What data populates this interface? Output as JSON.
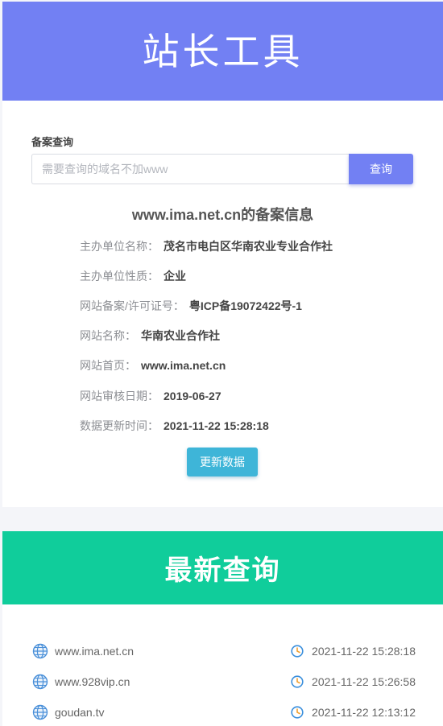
{
  "header": {
    "title": "站长工具"
  },
  "search": {
    "label": "备案查询",
    "placeholder": "需要查询的域名不加www",
    "button_label": "查询"
  },
  "info": {
    "title": "www.ima.net.cn的备案信息",
    "rows": [
      {
        "key": "主办单位名称：",
        "value": "茂名市电白区华南农业专业合作社"
      },
      {
        "key": "主办单位性质：",
        "value": "企业"
      },
      {
        "key": "网站备案/许可证号：",
        "value": "粤ICP备19072422号-1"
      },
      {
        "key": "网站名称：",
        "value": "华南农业合作社"
      },
      {
        "key": "网站首页：",
        "value": "www.ima.net.cn"
      },
      {
        "key": "网站审核日期：",
        "value": "2019-06-27"
      },
      {
        "key": "数据更新时间：",
        "value": "2021-11-22 15:28:18"
      }
    ],
    "update_button": "更新数据"
  },
  "recent": {
    "title": "最新查询",
    "items": [
      {
        "domain": "www.ima.net.cn",
        "time": "2021-11-22 15:28:18"
      },
      {
        "domain": "www.928vip.cn",
        "time": "2021-11-22 15:26:58"
      },
      {
        "domain": "goudan.tv",
        "time": "2021-11-22 12:13:12"
      }
    ]
  },
  "colors": {
    "primary": "#7280f3",
    "update_button": "#3eb5d8",
    "recent_header": "#10cd9b",
    "globe_icon": "#4a90d9",
    "clock_icon": "#3b8fdc"
  }
}
